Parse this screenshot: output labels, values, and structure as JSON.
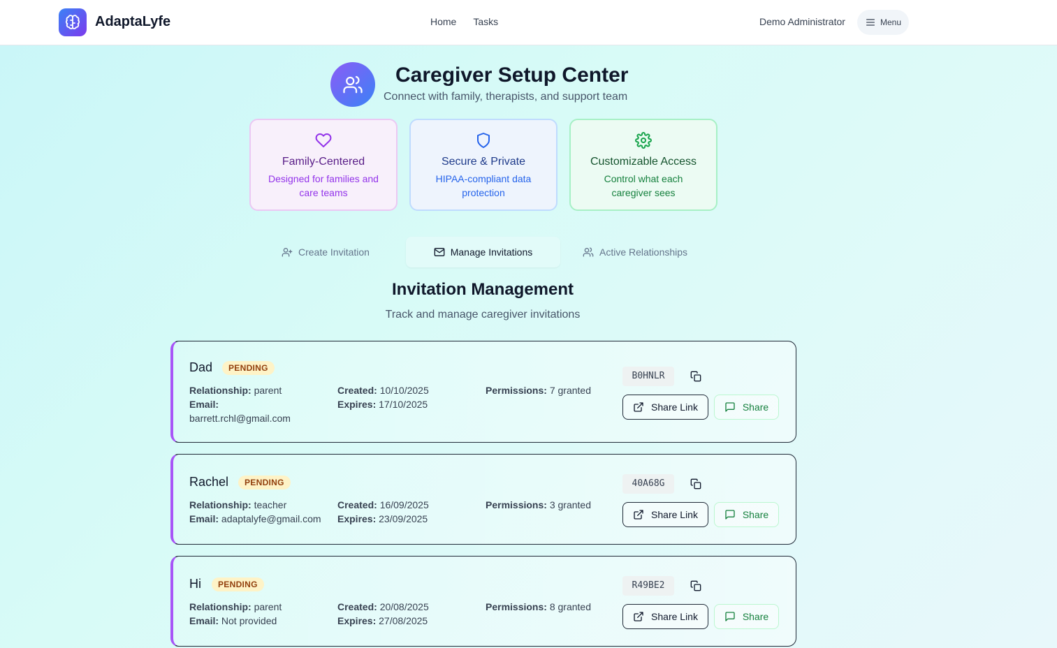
{
  "header": {
    "brand": "AdaptaLyfe",
    "nav": [
      "Home",
      "Tasks"
    ],
    "user": "Demo Administrator",
    "menu_label": "Menu"
  },
  "hero": {
    "title": "Caregiver Setup Center",
    "subtitle": "Connect with family, therapists, and support team"
  },
  "features": [
    {
      "title": "Family-Centered",
      "desc": "Designed for families and care teams",
      "icon": "heart-icon"
    },
    {
      "title": "Secure & Private",
      "desc": "HIPAA-compliant data protection",
      "icon": "shield-icon"
    },
    {
      "title": "Customizable Access",
      "desc": "Control what each caregiver sees",
      "icon": "gear-icon"
    }
  ],
  "tabs": [
    {
      "label": "Create Invitation",
      "icon": "user-plus-icon"
    },
    {
      "label": "Manage Invitations",
      "icon": "mail-icon",
      "active": true
    },
    {
      "label": "Active Relationships",
      "icon": "users-icon"
    }
  ],
  "section": {
    "title": "Invitation Management",
    "subtitle": "Track and manage caregiver invitations"
  },
  "labels": {
    "relationship": "Relationship:",
    "email": "Email:",
    "created": "Created:",
    "expires": "Expires:",
    "permissions": "Permissions:",
    "share_link": "Share Link",
    "share": "Share"
  },
  "invitations": [
    {
      "name": "Dad",
      "status": "PENDING",
      "relationship": "parent",
      "email": "barrett.rchl@gmail.com",
      "created": "10/10/2025",
      "expires": "17/10/2025",
      "permissions": "7 granted",
      "code": "B0HNLR"
    },
    {
      "name": "Rachel",
      "status": "PENDING",
      "relationship": "teacher",
      "email": "adaptalyfe@gmail.com",
      "created": "16/09/2025",
      "expires": "23/09/2025",
      "permissions": "3 granted",
      "code": "40A68G"
    },
    {
      "name": "Hi",
      "status": "PENDING",
      "relationship": "parent",
      "email": "Not provided",
      "created": "20/08/2025",
      "expires": "27/08/2025",
      "permissions": "8 granted",
      "code": "R49BE2"
    }
  ],
  "colors": {
    "accent_purple": "#a855f7",
    "pending_bg": "#fef3c7",
    "share_green": "#15803d"
  }
}
